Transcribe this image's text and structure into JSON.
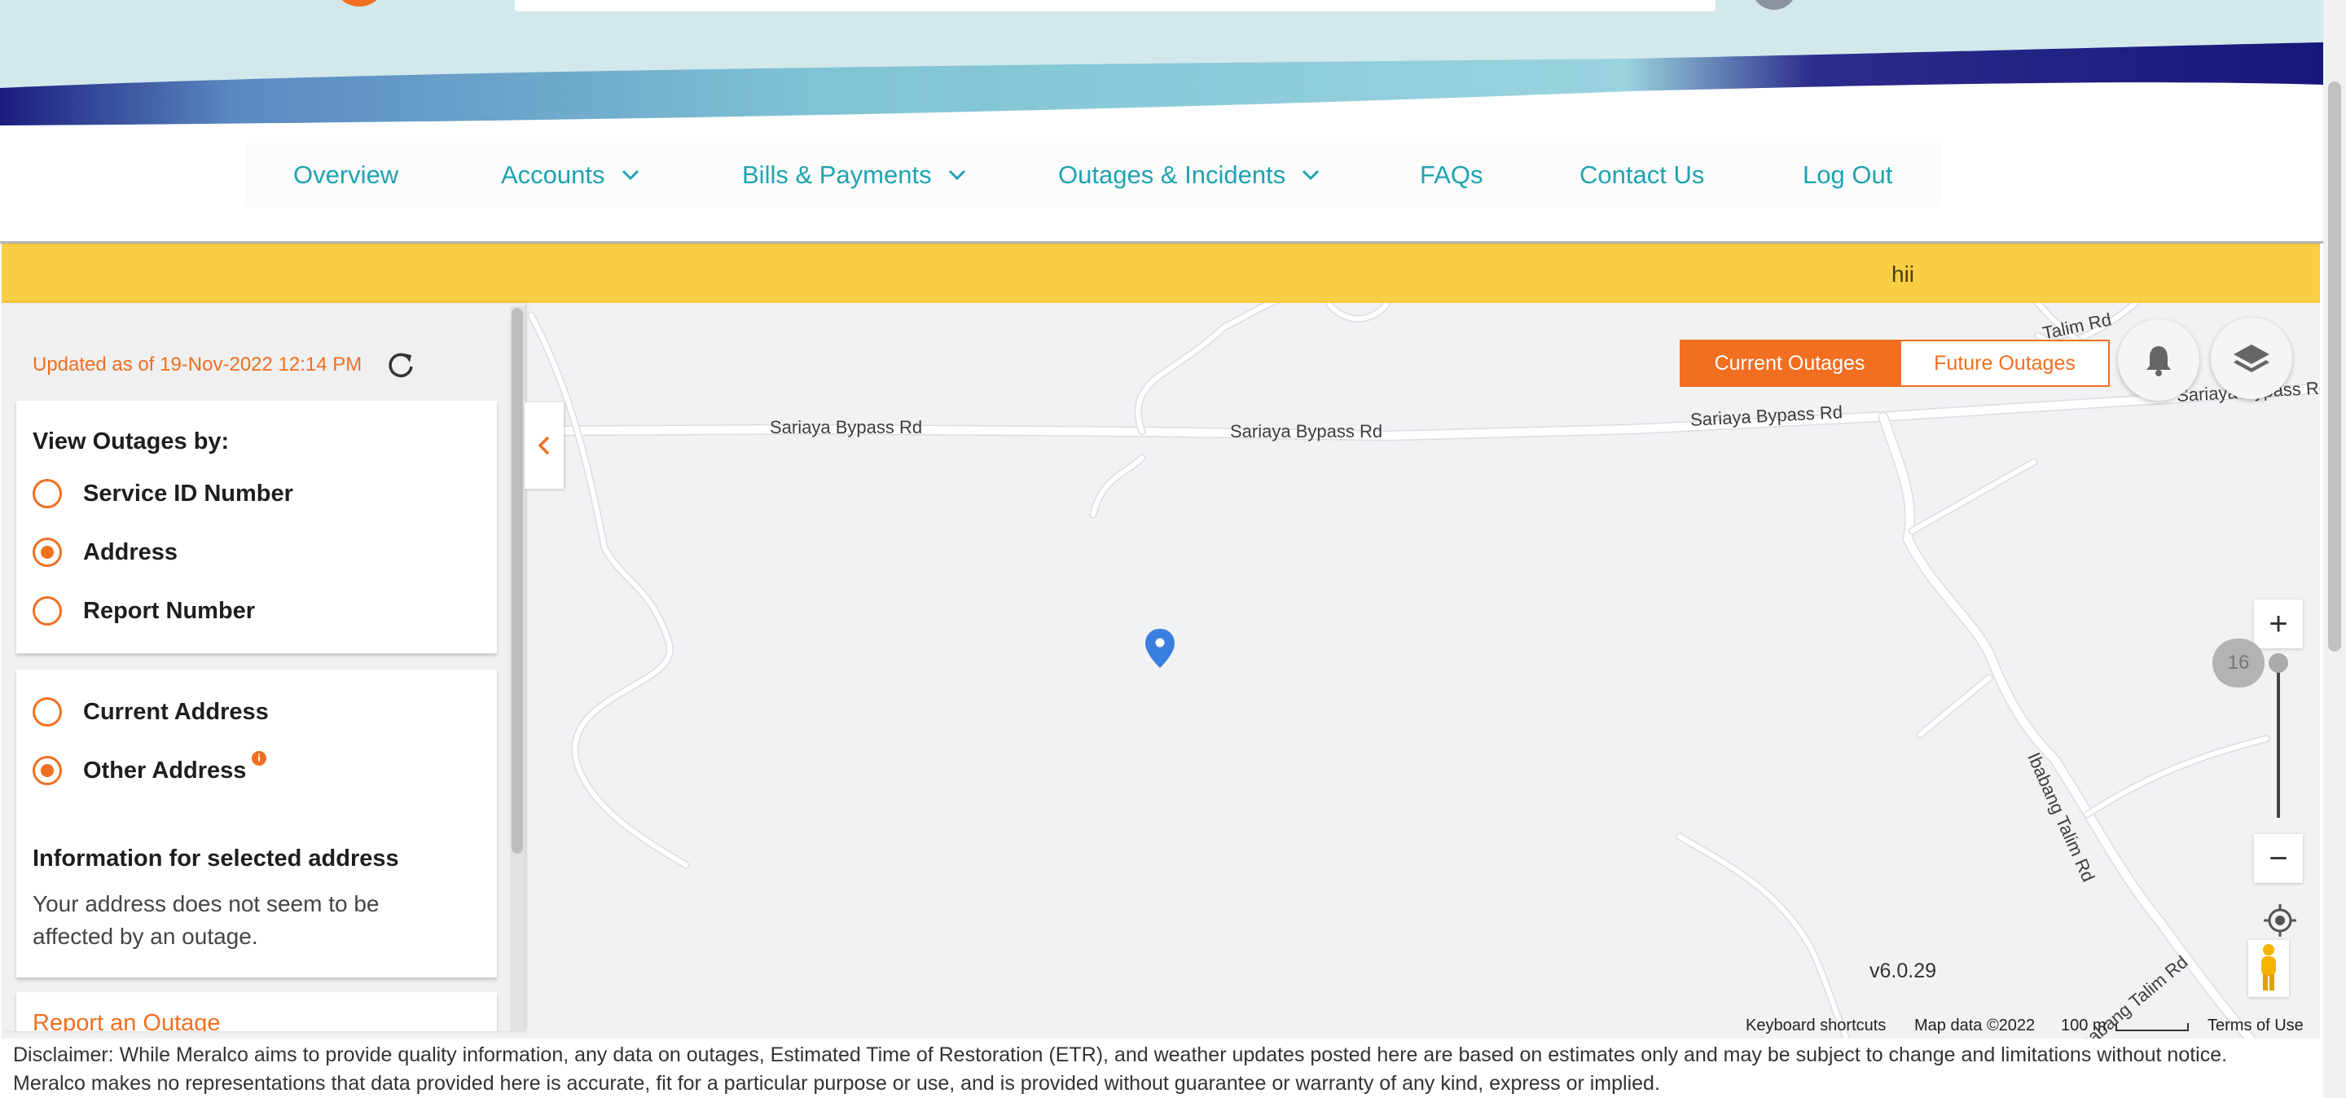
{
  "nav": {
    "items": [
      {
        "label": "Overview"
      },
      {
        "label": "Accounts"
      },
      {
        "label": "Bills & Payments"
      },
      {
        "label": "Outages & Incidents"
      },
      {
        "label": "FAQs"
      },
      {
        "label": "Contact Us"
      },
      {
        "label": "Log Out"
      }
    ]
  },
  "banner": {
    "text": "hii"
  },
  "panel": {
    "updated": "Updated as of 19-Nov-2022 12:14 PM",
    "view_by": {
      "title": "View Outages by:",
      "options": [
        {
          "label": "Service ID Number",
          "selected": false
        },
        {
          "label": "Address",
          "selected": true
        },
        {
          "label": "Report Number",
          "selected": false
        }
      ]
    },
    "address": {
      "options": [
        {
          "label": "Current Address",
          "selected": false
        },
        {
          "label": "Other Address",
          "selected": true
        }
      ],
      "info_badge": "i",
      "info_title": "Information for selected address",
      "info_text": "Your address does not seem to be affected by an outage."
    },
    "report_link": "Report an Outage"
  },
  "map": {
    "toggle": {
      "current": "Current Outages",
      "future": "Future Outages",
      "active": "current"
    },
    "road_labels": {
      "r1": "Sariaya Bypass Rd",
      "r2": "Sariaya Bypass Rd",
      "r3": "Sariaya Bypass Rd",
      "r4": "Talim Rd",
      "r5": "Sariaya Bypass Rd",
      "r6": "Ibabang Talim Rd",
      "r7": "Ibabang Talim Rd"
    },
    "zoom_level": "16",
    "zoom_in": "+",
    "zoom_out": "−",
    "version": "v6.0.29",
    "attribution": {
      "shortcuts": "Keyboard shortcuts",
      "map_data": "Map data ©2022",
      "scale": "100 m",
      "terms": "Terms of Use"
    },
    "marker_color": "#3a7fe0"
  },
  "disclaimer": {
    "line1": "Disclaimer: While Meralco aims to provide quality information, any data on outages, Estimated Time of Restoration (ETR), and weather updates posted here are based on estimates only and may be subject to change and limitations without notice.",
    "line2": "Meralco makes no representations that data provided here is accurate, fit for a particular purpose or use, and is provided without guarantee or warranty of any kind, express or implied."
  },
  "colors": {
    "accent": "#f26f21",
    "nav_text": "#1fa3b0",
    "banner": "#f9ce45",
    "header_bg": "#d2e8eb",
    "wave_dark": "#1a1a7a"
  }
}
